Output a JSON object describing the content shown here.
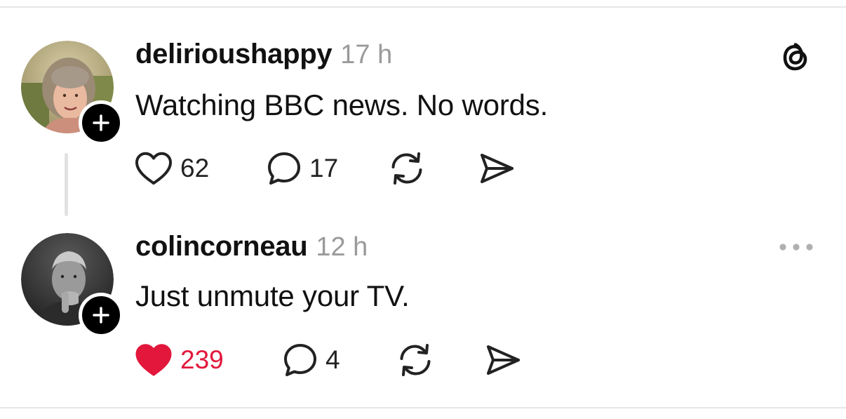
{
  "posts": [
    {
      "username": "delirioushappy",
      "time": "17 h",
      "text": "Watching BBC news.  No words.",
      "likes": "62",
      "replies": "17",
      "liked": false,
      "corner_icon": "threads-logo-icon"
    },
    {
      "username": "colincorneau",
      "time": "12 h",
      "text": "Just unmute your TV.",
      "likes": "239",
      "replies": "4",
      "liked": true,
      "corner_icon": "more-options-icon"
    }
  ],
  "colors": {
    "like_active": "#e2173b",
    "muted_text": "#9a9a9a"
  }
}
